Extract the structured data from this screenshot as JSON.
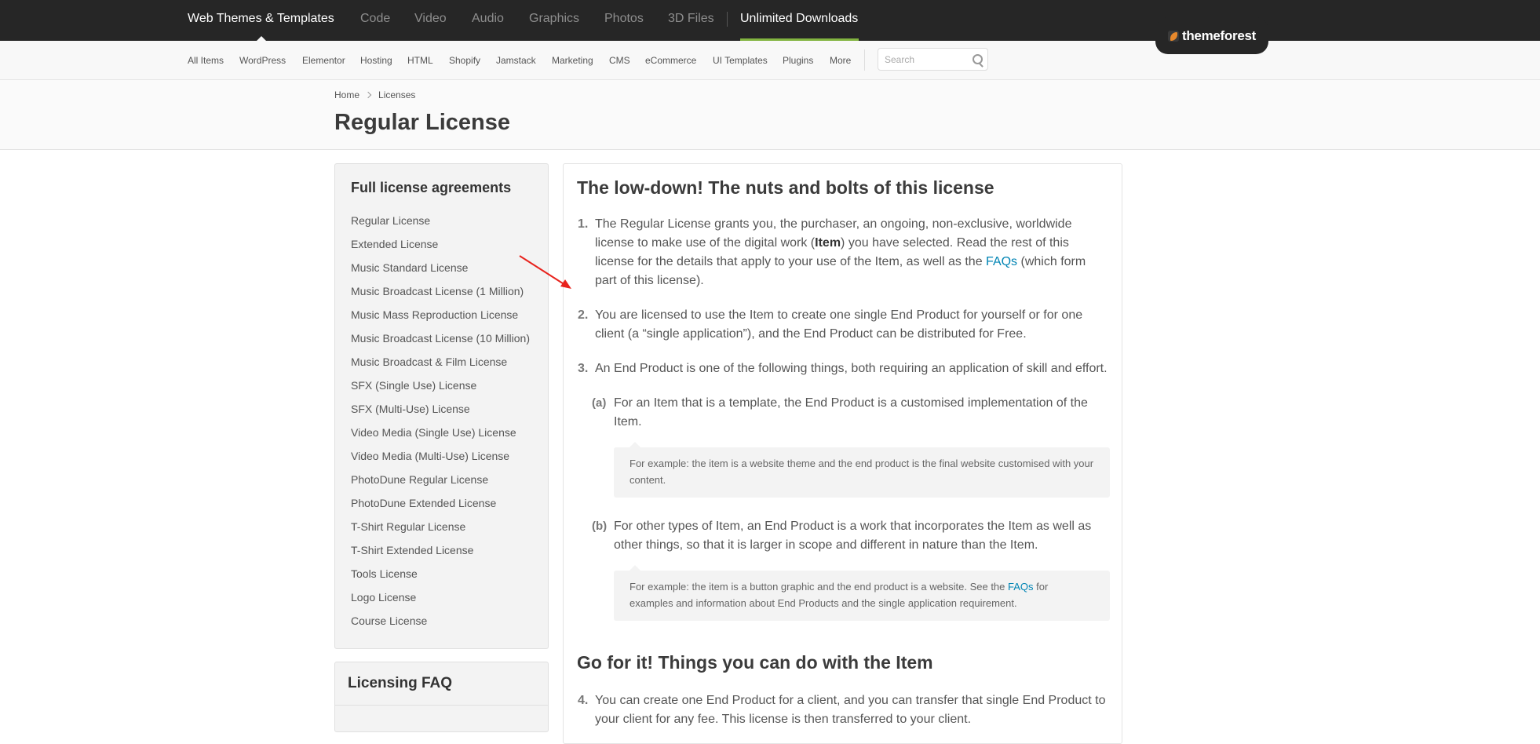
{
  "topbar": {
    "categories": [
      "Web Themes & Templates",
      "Code",
      "Video",
      "Audio",
      "Graphics",
      "Photos",
      "3D Files"
    ],
    "unlimited": "Unlimited Downloads",
    "brand": "themeforest",
    "accent_color": "#82b440",
    "brand_icon": "leaf-logo-icon"
  },
  "subnav": {
    "items": [
      "All Items",
      "WordPress",
      "Elementor",
      "Hosting",
      "HTML",
      "Shopify",
      "Jamstack",
      "Marketing",
      "CMS",
      "eCommerce",
      "UI Templates",
      "Plugins",
      "More"
    ],
    "search_placeholder": "Search",
    "search_icon": "search-icon"
  },
  "breadcrumb": [
    "Home",
    "Licenses"
  ],
  "page_title": "Regular License",
  "sidebar": {
    "title": "Full license agreements",
    "items": [
      "Regular License",
      "Extended License",
      "Music Standard License",
      "Music Broadcast License (1 Million)",
      "Music Mass Reproduction License",
      "Music Broadcast License (10 Million)",
      "Music Broadcast & Film License",
      "SFX (Single Use) License",
      "SFX (Multi-Use) License",
      "Video Media (Single Use) License",
      "Video Media (Multi-Use) License",
      "PhotoDune Regular License",
      "PhotoDune Extended License",
      "T-Shirt Regular License",
      "T-Shirt Extended License",
      "Tools License",
      "Logo License",
      "Course License"
    ],
    "faq_title": "Licensing FAQ"
  },
  "main": {
    "heading1": "The low-down! The nuts and bolts of this license",
    "c1": {
      "num": "1.",
      "t1": "The Regular License grants you, the purchaser, an ongoing, non-exclusive, worldwide license to make use of the digital work (",
      "bold": "Item",
      "t2": ") you have selected. Read the rest of this license for the details that apply to your use of the Item, as well as the ",
      "link": "FAQs",
      "t3": " (which form part of this license)."
    },
    "c2": {
      "num": "2.",
      "text": "You are licensed to use the Item to create one single End Product for yourself or for one client (a “single application”), and the End Product can be distributed for Free."
    },
    "c3": {
      "num": "3.",
      "text": "An End Product is one of the following things, both requiring an application of skill and effort."
    },
    "c3a": {
      "num": "(a)",
      "text": "For an Item that is a template, the End Product is a customised implementation of the Item.",
      "note": "For example: the item is a website theme and the end product is the final website customised with your content."
    },
    "c3b": {
      "num": "(b)",
      "text": "For other types of Item, an End Product is a work that incorporates the Item as well as other things, so that it is larger in scope and different in nature than the Item.",
      "note1": "For example: the item is a button graphic and the end product is a website. See the ",
      "note_link": "FAQs",
      "note2": " for examples and information about End Products and the single application requirement."
    },
    "heading2": "Go for it! Things you can do with the Item",
    "c4": {
      "num": "4.",
      "text": "You can create one End Product for a client, and you can transfer that single End Product to your client for any fee. This license is then transferred to your client."
    }
  },
  "annotation": {
    "arrow_color": "#e8231d",
    "arrow_icon": "red-arrow-icon"
  }
}
